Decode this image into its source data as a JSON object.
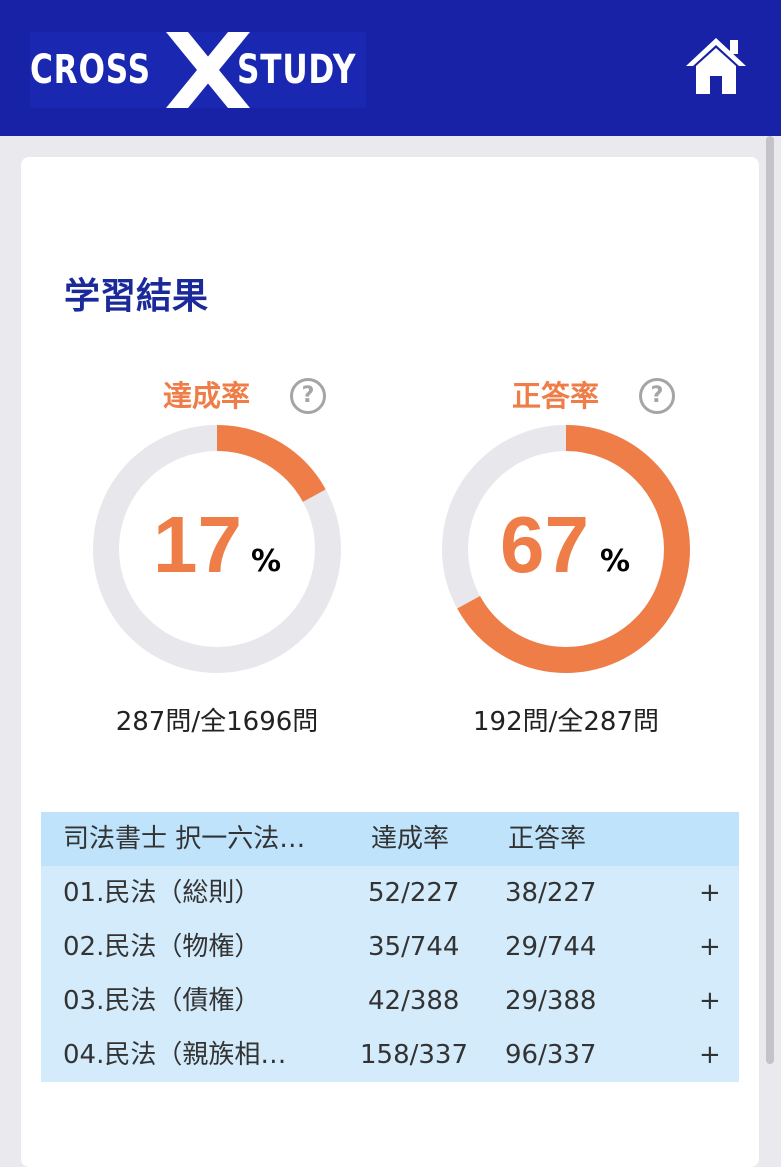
{
  "header": {
    "logo_left": "CROSS",
    "logo_right": "STUDY",
    "home_icon": "home-icon"
  },
  "page": {
    "title": "学習結果"
  },
  "metrics": {
    "achievement": {
      "label": "達成率",
      "percent_value": 17,
      "percent": "17",
      "unit": "%",
      "count": "287問/全1696問"
    },
    "correct": {
      "label": "正答率",
      "percent_value": 67,
      "percent": "67",
      "unit": "%",
      "count": "192問/全287問"
    },
    "help_icon": "question-icon",
    "colors": {
      "accent": "#ef7d48",
      "track": "#e7e7ec"
    }
  },
  "table": {
    "headers": [
      "司法書士 択一六法…",
      "達成率",
      "正答率"
    ],
    "rows": [
      {
        "name": "01.民法（総則）",
        "achievement": "52/227",
        "correct": "38/227",
        "expand": "+"
      },
      {
        "name": "02.民法（物権）",
        "achievement": "35/744",
        "correct": "29/744",
        "expand": "+"
      },
      {
        "name": "03.民法（債権）",
        "achievement": "42/388",
        "correct": "29/388",
        "expand": "+"
      },
      {
        "name": "04.民法（親族相…",
        "achievement": "158/337",
        "correct": "96/337",
        "expand": "+"
      }
    ]
  }
}
